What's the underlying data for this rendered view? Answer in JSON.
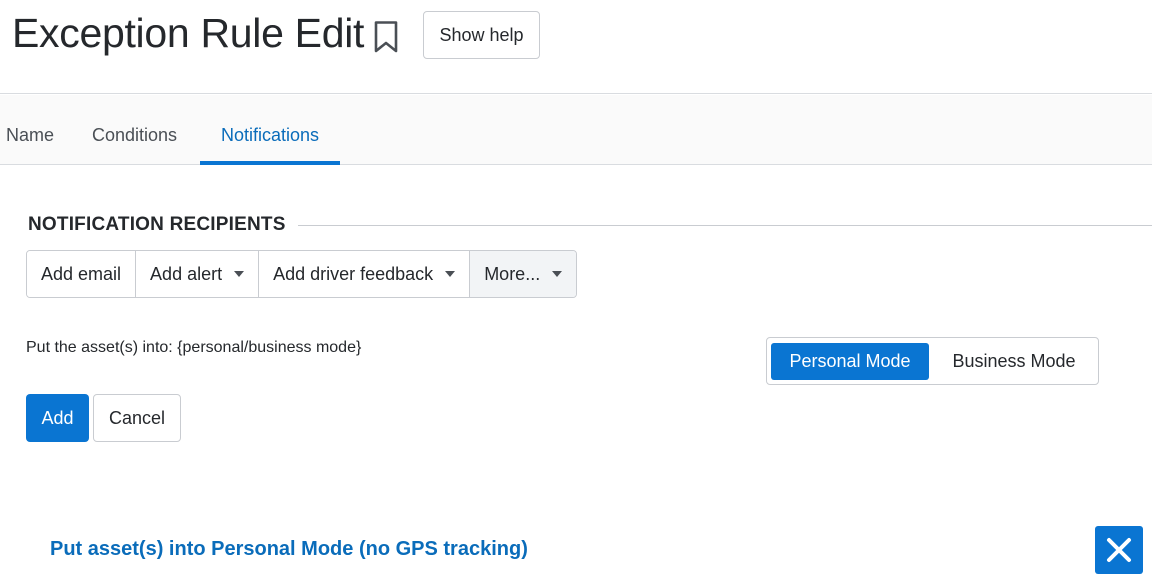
{
  "header": {
    "title": "Exception Rule Edit",
    "show_help_label": "Show help"
  },
  "tabs": [
    {
      "label": "Name",
      "active": false
    },
    {
      "label": "Conditions",
      "active": false
    },
    {
      "label": "Notifications",
      "active": true
    }
  ],
  "recipients": {
    "heading": "NOTIFICATION RECIPIENTS",
    "buttons": [
      {
        "label": "Add email",
        "has_dropdown": false
      },
      {
        "label": "Add alert",
        "has_dropdown": true
      },
      {
        "label": "Add driver feedback",
        "has_dropdown": true
      },
      {
        "label": "More...",
        "has_dropdown": true
      }
    ]
  },
  "mode": {
    "instruction": "Put the asset(s) into: {personal/business mode}",
    "options": [
      "Personal Mode",
      "Business Mode"
    ],
    "selected": "Personal Mode"
  },
  "actions": {
    "add_label": "Add",
    "cancel_label": "Cancel"
  },
  "notification_item": {
    "label": "Put asset(s) into Personal Mode (no GPS tracking)",
    "remove_icon": "close-icon"
  },
  "colors": {
    "accent": "#0a75d2",
    "link": "#0a6cba",
    "text": "#25282c",
    "border": "#c9ccd1"
  }
}
